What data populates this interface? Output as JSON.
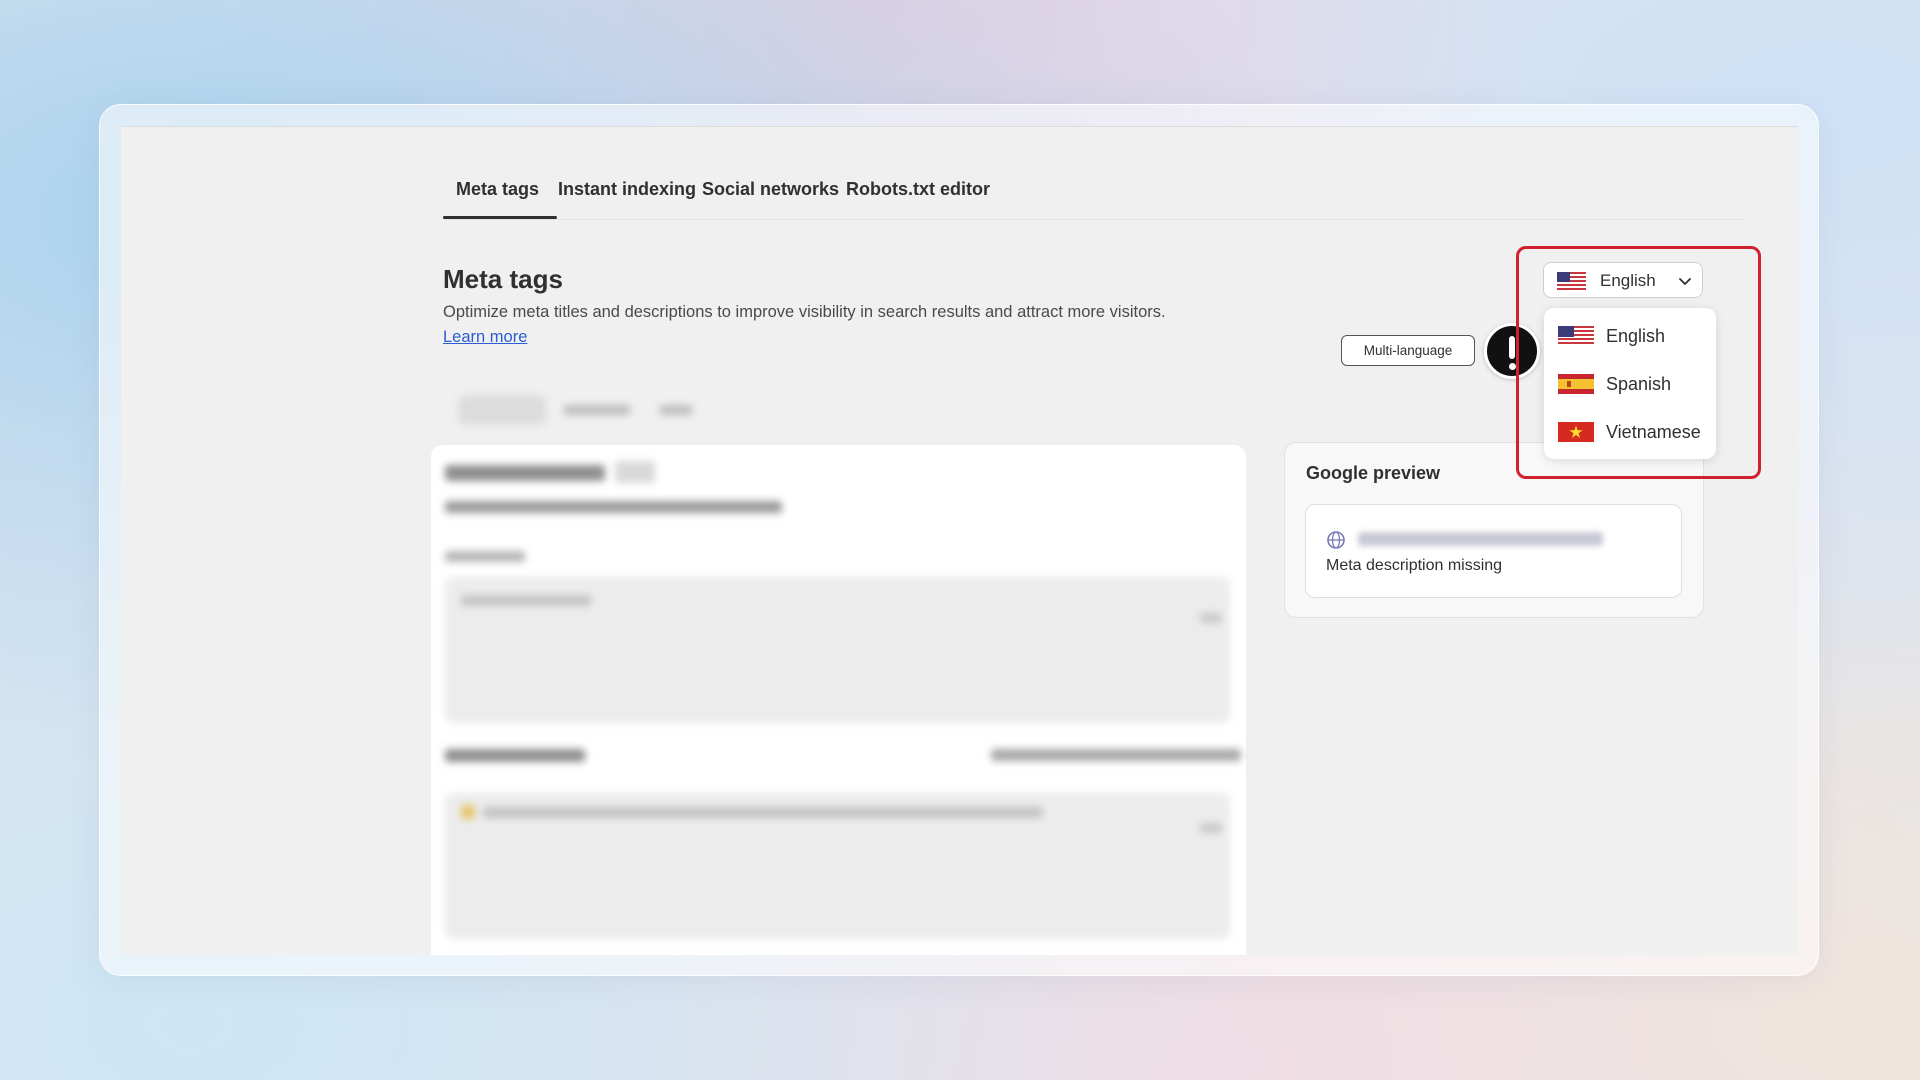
{
  "tabs": [
    {
      "label": "Meta tags",
      "active": true
    },
    {
      "label": "Instant indexing",
      "active": false
    },
    {
      "label": "Social networks",
      "active": false
    },
    {
      "label": "Robots.txt editor",
      "active": false
    }
  ],
  "header": {
    "title": "Meta tags",
    "subtitle": "Optimize meta titles and descriptions to improve visibility in search results and attract more visitors.",
    "learn_more": "Learn more"
  },
  "preview": {
    "title": "Google preview",
    "missing_text": "Meta description missing"
  },
  "multi_language_badge": "Multi-language",
  "language_selector": {
    "selected": "English",
    "options": [
      {
        "label": "English",
        "flag": "us-flag-icon"
      },
      {
        "label": "Spanish",
        "flag": "spain-flag-icon"
      },
      {
        "label": "Vietnamese",
        "flag": "vietnam-flag-icon"
      }
    ]
  },
  "colors": {
    "highlight_border": "#d1212f",
    "link": "#2c5dd4",
    "text": "#303030"
  }
}
